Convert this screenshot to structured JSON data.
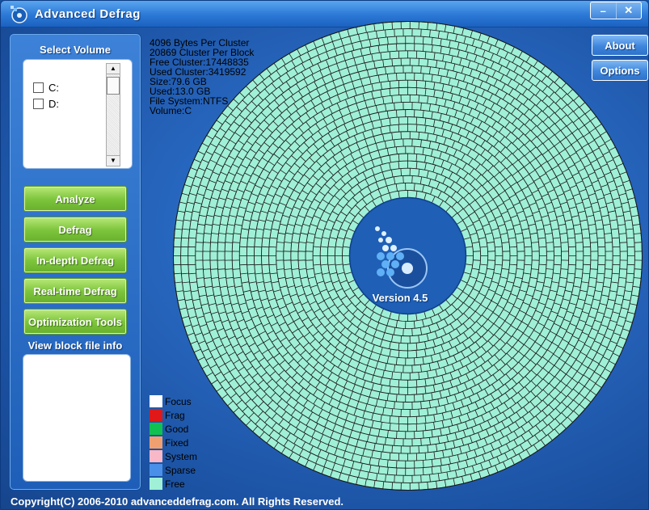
{
  "window": {
    "title": "Advanced Defrag",
    "minimize_label": "–",
    "close_label": "✕"
  },
  "sidebar": {
    "select_volume_heading": "Select Volume",
    "volumes": [
      {
        "label": "C:",
        "checked": false
      },
      {
        "label": "D:",
        "checked": false
      }
    ],
    "buttons": {
      "analyze": "Analyze",
      "defrag": "Defrag",
      "indepth": "In-depth Defrag",
      "realtime": "Real-time Defrag",
      "optimization": "Optimization Tools"
    },
    "block_info_heading": "View block file info"
  },
  "stats": {
    "bytes_per_cluster": "4096 Bytes Per Cluster",
    "cluster_per_block": "20869 Cluster Per Block",
    "free_cluster": "Free Cluster:17448835",
    "used_cluster": "Used Cluster:3419592",
    "size": "Size:79.6 GB",
    "used": "Used:13.0 GB",
    "file_system": "File System:NTFS",
    "volume": "Volume:C"
  },
  "top_buttons": {
    "about": "About",
    "options": "Options"
  },
  "disk": {
    "version": "Version 4.5",
    "free_color": "#9ff0d6",
    "ring_count": 24,
    "block_state": "Free"
  },
  "legend": [
    {
      "label": "Focus",
      "color": "#ffffff"
    },
    {
      "label": "Frag",
      "color": "#e01818"
    },
    {
      "label": "Good",
      "color": "#10c050"
    },
    {
      "label": "Fixed",
      "color": "#f0a070"
    },
    {
      "label": "System",
      "color": "#f8b8c8"
    },
    {
      "label": "Sparse",
      "color": "#4a90e8"
    },
    {
      "label": "Free",
      "color": "#9ff0d6"
    }
  ],
  "footer": {
    "copyright": "Copyright(C) 2006-2010 advanceddefrag.com. All Rights Reserved."
  }
}
